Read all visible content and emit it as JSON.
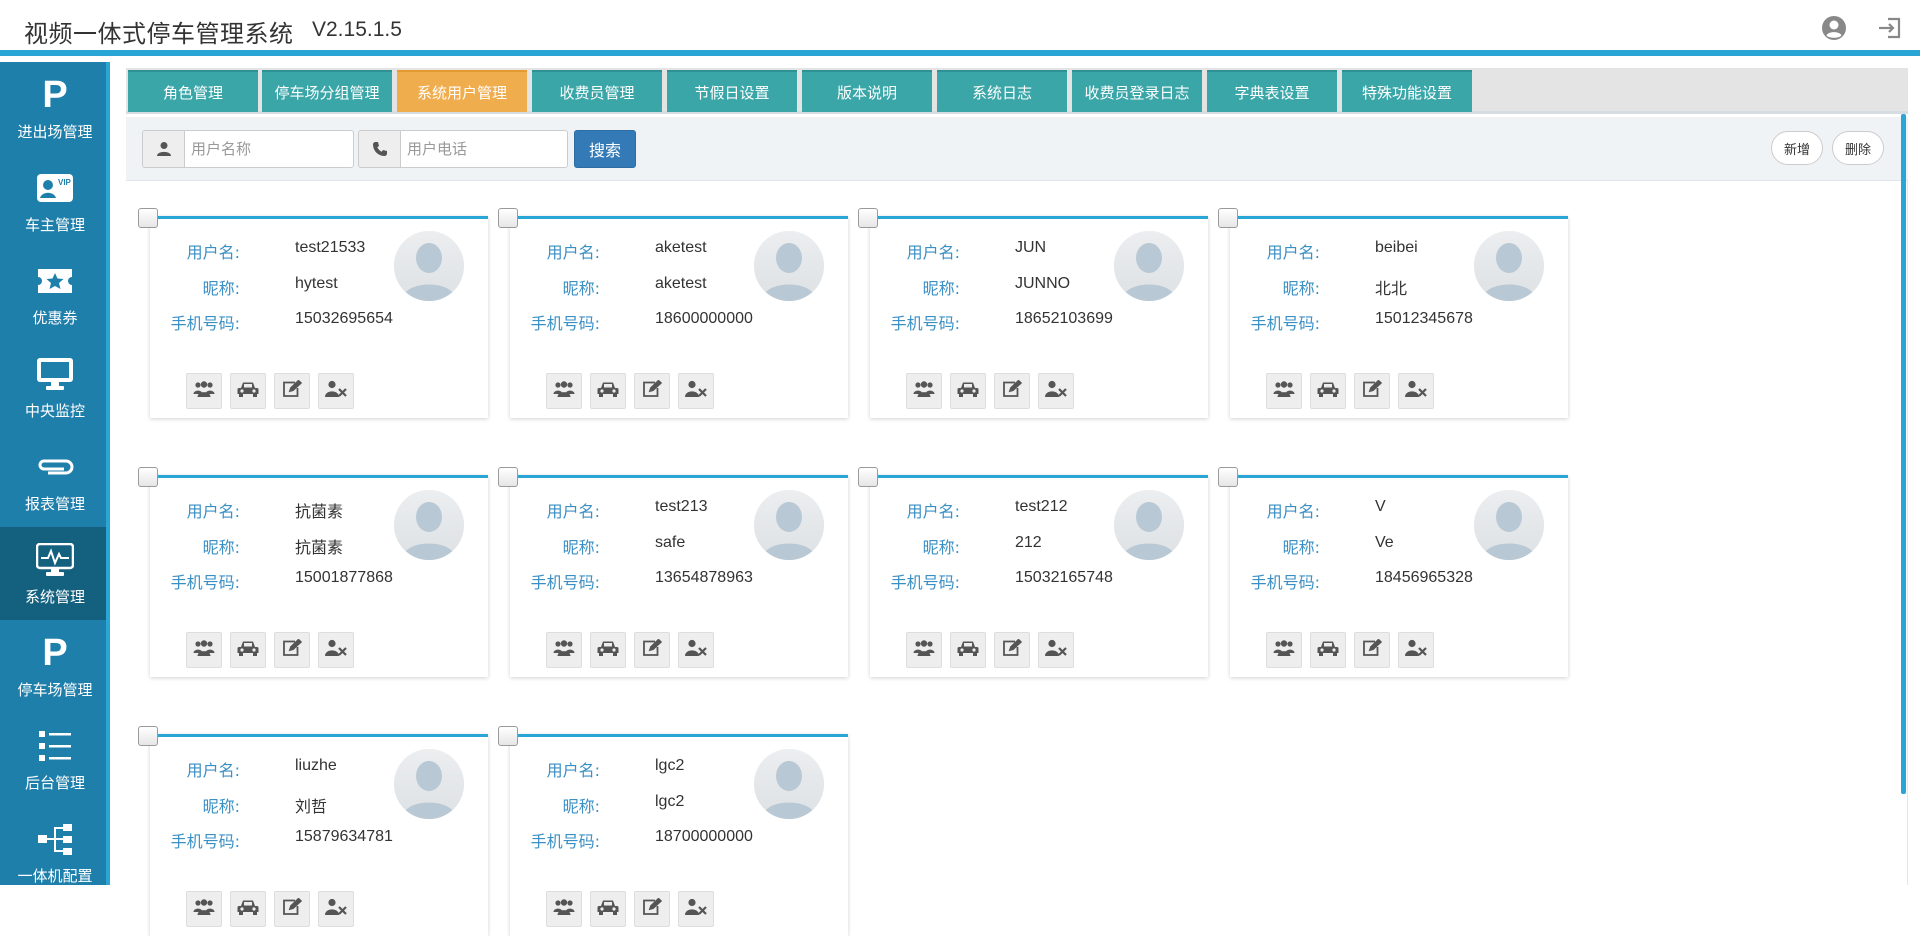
{
  "header": {
    "title": "视频一体式停车管理系统",
    "version": "V2.15.1.5"
  },
  "sidebar": {
    "items": [
      {
        "label": "进出场管理",
        "icon": "parking-p-icon"
      },
      {
        "label": "车主管理",
        "icon": "vip-card-icon"
      },
      {
        "label": "优惠券",
        "icon": "coupon-star-icon"
      },
      {
        "label": "中央监控",
        "icon": "monitor-icon"
      },
      {
        "label": "报表管理",
        "icon": "paperclip-icon"
      },
      {
        "label": "系统管理",
        "icon": "system-monitor-icon",
        "active": true
      },
      {
        "label": "停车场管理",
        "icon": "parking-p-icon"
      },
      {
        "label": "后台管理",
        "icon": "list-icon"
      },
      {
        "label": "一体机配置",
        "icon": "sitemap-icon"
      }
    ]
  },
  "tabs": [
    {
      "label": "角色管理"
    },
    {
      "label": "停车场分组管理"
    },
    {
      "label": "系统用户管理",
      "active": true
    },
    {
      "label": "收费员管理"
    },
    {
      "label": "节假日设置"
    },
    {
      "label": "版本说明"
    },
    {
      "label": "系统日志"
    },
    {
      "label": "收费员登录日志"
    },
    {
      "label": "字典表设置"
    },
    {
      "label": "特殊功能设置"
    }
  ],
  "toolbar": {
    "username_placeholder": "用户名称",
    "phone_placeholder": "用户电话",
    "search_label": "搜索",
    "add_label": "新增",
    "delete_label": "删除"
  },
  "labels": {
    "username": "用户名:",
    "nickname": "昵称:",
    "phone": "手机号码:"
  },
  "colors": {
    "accent": "#2aa6d6",
    "sidebar": "#1f7fab",
    "tab": "#3aa6a8",
    "tab_active": "#f0ad4e",
    "label": "#3a8fc4",
    "search_button": "#337ab7"
  },
  "users": [
    {
      "username": "test21533",
      "nickname": "hytest",
      "phone": "15032695654"
    },
    {
      "username": "aketest",
      "nickname": "aketest",
      "phone": "18600000000"
    },
    {
      "username": "JUN",
      "nickname": "JUNNO",
      "phone": "18652103699"
    },
    {
      "username": "beibei",
      "nickname": "北北",
      "phone": "15012345678"
    },
    {
      "username": "抗菌素",
      "nickname": "抗菌素",
      "phone": "15001877868"
    },
    {
      "username": "test213",
      "nickname": "safe",
      "phone": "13654878963"
    },
    {
      "username": "test212",
      "nickname": "212",
      "phone": "15032165748"
    },
    {
      "username": "V",
      "nickname": "Ve",
      "phone": "18456965328"
    },
    {
      "username": "liuzhe",
      "nickname": "刘哲",
      "phone": "15879634781"
    },
    {
      "username": "lgc2",
      "nickname": "lgc2",
      "phone": "18700000000"
    }
  ]
}
